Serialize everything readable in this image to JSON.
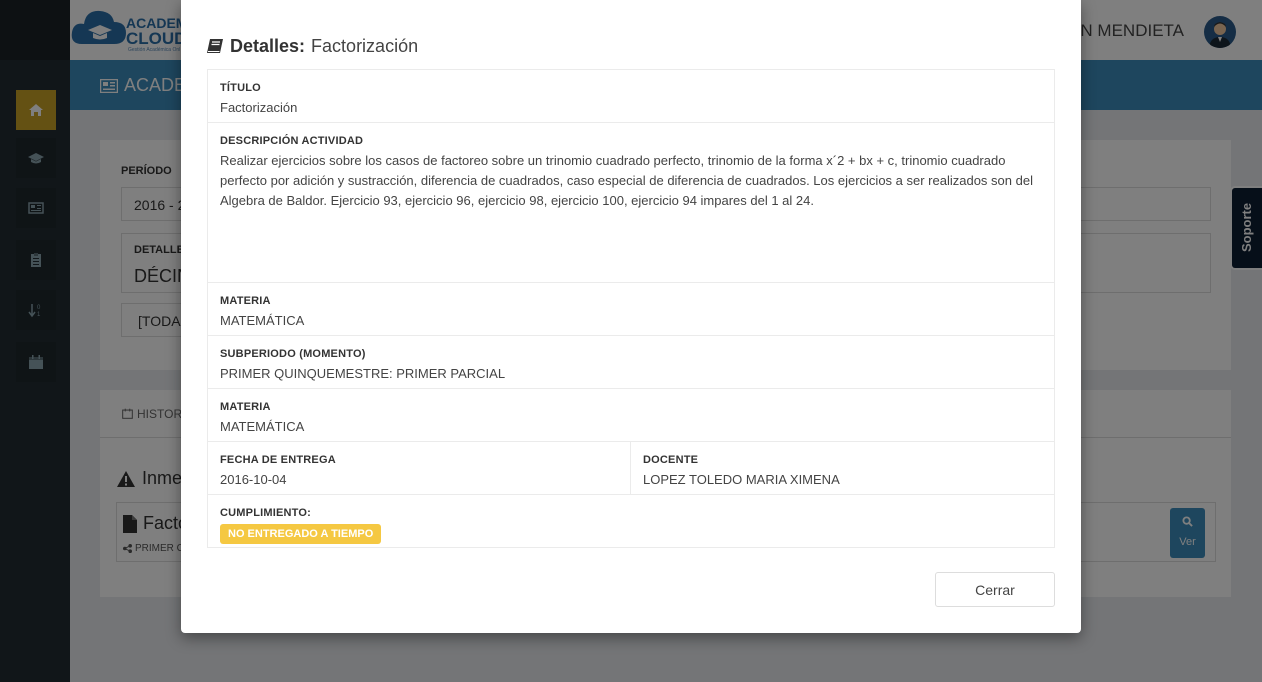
{
  "app": {
    "logo_text_top": "ACADEMI",
    "logo_text_bottom": "CLOUD",
    "logo_sub": "Gestión Académica Onl",
    "user_name": "SON MENDIETA",
    "section_title": "ACADE"
  },
  "sidebar": {
    "items": [
      {
        "icon": "home-icon",
        "active": true
      },
      {
        "icon": "graduation-cap-icon",
        "active": false
      },
      {
        "icon": "newspaper-icon",
        "active": false
      },
      {
        "icon": "clipboard-icon",
        "active": false
      },
      {
        "icon": "sort-numeric-icon",
        "active": false
      },
      {
        "icon": "calendar-icon",
        "active": false
      }
    ]
  },
  "background": {
    "periodo_label": "PERÍODO",
    "periodo_value": "2016 - 2",
    "detalle_label": "DETALLE",
    "detalle_value": "DÉCIN",
    "filter_value": "[TODA",
    "tab_history": "HISTOR",
    "warning_title": "Inme",
    "task_title": "Facto",
    "task_sub": "PRIMER C",
    "ver_label": "Ver",
    "soporte": "Soporte"
  },
  "modal": {
    "title_strong": "Detalles:",
    "title_light": "Factorización",
    "titulo_label": "TÍTULO",
    "titulo_value": "Factorización",
    "descripcion_label": "DESCRIPCIÓN ACTIVIDAD",
    "descripcion_value": "Realizar ejercicios sobre los casos de factoreo sobre un trinomio cuadrado perfecto, trinomio de la forma x´2 + bx + c, trinomio cuadrado perfecto por adición y sustracción, diferencia de cuadrados, caso especial de diferencia de cuadrados. Los ejercicios a ser realizados son del Algebra de Baldor. Ejercicio 93, ejercicio 96, ejercicio 98, ejercicio 100, ejercicio 94 impares del 1 al 24.",
    "materia_label": "MATERIA",
    "materia_value": "MATEMÁTICA",
    "subperiodo_label": "SUBPERIODO (MOMENTO)",
    "subperiodo_value": "PRIMER QUINQUEMESTRE: PRIMER PARCIAL",
    "materia2_label": "MATERIA",
    "materia2_value": "MATEMÁTICA",
    "fecha_label": "FECHA DE ENTREGA",
    "fecha_value": "2016-10-04",
    "docente_label": "DOCENTE",
    "docente_value": "LOPEZ TOLEDO MARIA XIMENA",
    "cumplimiento_label": "CUMPLIMIENTO:",
    "cumplimiento_badge": "NO ENTREGADO A TIEMPO",
    "close_label": "Cerrar"
  },
  "colors": {
    "sidebar_bg": "#222d32",
    "active_item": "#c9a227",
    "header_blue": "#3c8dbc",
    "badge_warning": "#f5c842"
  }
}
